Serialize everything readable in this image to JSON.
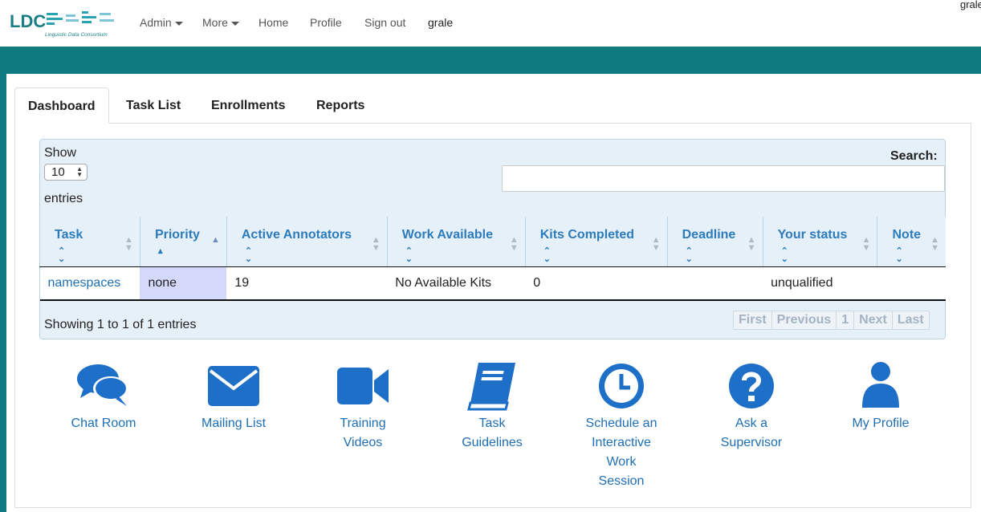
{
  "brand": {
    "logo_text": "LDC",
    "logo_subtitle": "Linguistic Data Consortium"
  },
  "nav": {
    "items": [
      {
        "label": "Admin",
        "dropdown": true
      },
      {
        "label": "More",
        "dropdown": true
      },
      {
        "label": "Home",
        "dropdown": false
      },
      {
        "label": "Profile",
        "dropdown": false
      },
      {
        "label": "Sign out",
        "dropdown": false
      }
    ],
    "user": "grale",
    "corner_user": "grale"
  },
  "tabs": [
    {
      "label": "Dashboard",
      "active": true
    },
    {
      "label": "Task List",
      "active": false
    },
    {
      "label": "Enrollments",
      "active": false
    },
    {
      "label": "Reports",
      "active": false
    }
  ],
  "table_controls": {
    "show_label": "Show",
    "page_length": "10",
    "entries_label": "entries",
    "search_label": "Search:",
    "search_value": ""
  },
  "table": {
    "columns": [
      "Task",
      "Priority",
      "Active Annotators",
      "Work Available",
      "Kits Completed",
      "Deadline",
      "Your status",
      "Note"
    ],
    "sorted_column": "Priority",
    "rows": [
      {
        "task": "namespaces",
        "priority": "none",
        "active_annotators": "19",
        "work_available": "No Available Kits",
        "kits_completed": "0",
        "deadline": "",
        "your_status": "unqualified",
        "note": ""
      }
    ]
  },
  "footer": {
    "info": "Showing 1 to 1 of 1 entries",
    "pager": {
      "first": "First",
      "previous": "Previous",
      "page": "1",
      "next": "Next",
      "last": "Last"
    }
  },
  "tiles": [
    {
      "label_lines": [
        "Chat Room"
      ],
      "icon": "chat-bubbles-icon"
    },
    {
      "label_lines": [
        "Mailing List"
      ],
      "icon": "envelope-icon"
    },
    {
      "label_lines": [
        "Training",
        "Videos"
      ],
      "icon": "video-camera-icon"
    },
    {
      "label_lines": [
        "Task",
        "Guidelines"
      ],
      "icon": "book-icon"
    },
    {
      "label_lines": [
        "Schedule an",
        "Interactive",
        "Work",
        "Session"
      ],
      "icon": "clock-icon"
    },
    {
      "label_lines": [
        "Ask a",
        "Supervisor"
      ],
      "icon": "question-circle-icon"
    },
    {
      "label_lines": [
        "My Profile"
      ],
      "icon": "user-icon"
    }
  ],
  "colors": {
    "teal": "#0f7b80",
    "link_blue": "#1f6fb2",
    "icon_blue": "#1e6fc8",
    "header_bg": "#e6f0f8",
    "sorted_cell": "#d4d8fb"
  }
}
